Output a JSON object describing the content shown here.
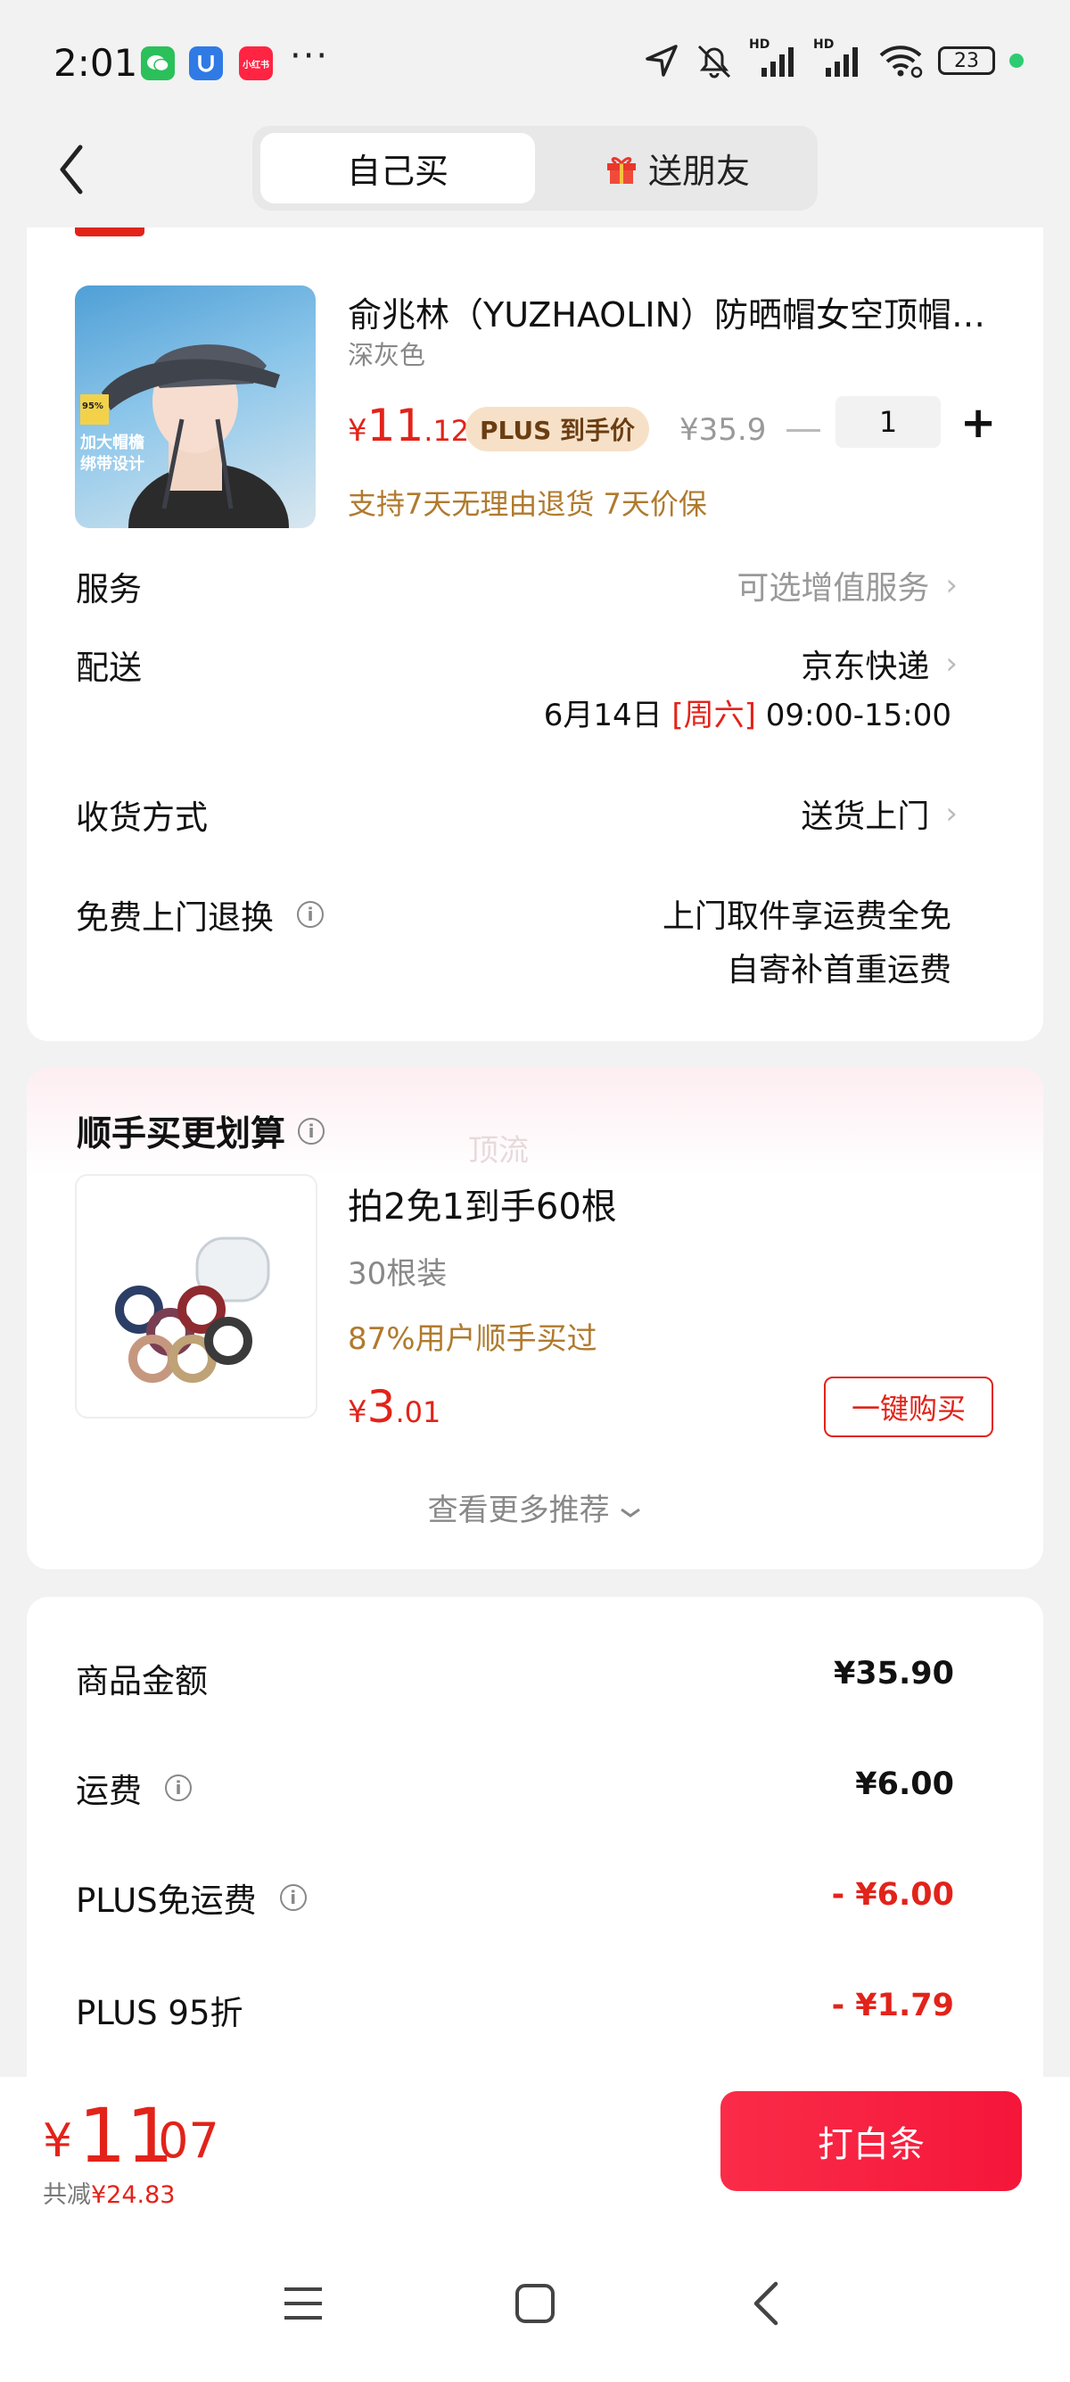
{
  "status_bar": {
    "time": "2:01",
    "apps": [
      "wechat-icon",
      "security-app-icon",
      "xiaohongshu-icon"
    ],
    "xhs_label": "小红书",
    "dots": "···",
    "hd1": "HD",
    "hd2": "HD",
    "battery": "23"
  },
  "header": {
    "tab_self": "自己买",
    "tab_gift": "送朋友"
  },
  "product": {
    "title": "俞兆林（YUZHAOLIN）防晒帽女空顶帽遮阳帽",
    "spec": "深灰色",
    "price_yen": "¥",
    "price_int": "11",
    "price_dec": ".12",
    "plus_pill": "PLUS 到手价",
    "orig_price": "¥35.9",
    "qty": "1",
    "policy": "支持7天无理由退货  7天价保",
    "img_badge": "95%",
    "img_text1": "加大帽檐",
    "img_text2": "绑带设计"
  },
  "rows": {
    "service_label": "服务",
    "service_value": "可选增值服务",
    "delivery_label": "配送",
    "delivery_value": "京东快递",
    "delivery_date": "6月14日",
    "delivery_weekday": "[周六]",
    "delivery_time": "09:00-15:00",
    "receive_label": "收货方式",
    "receive_value": "送货上门",
    "return_label": "免费上门退换",
    "return_line1": "上门取件享运费全免",
    "return_line2": "自寄补首重运费"
  },
  "recommend": {
    "title": "顺手买更划算",
    "watermark": "顶流",
    "item_title": "拍2免1到手60根",
    "item_spec": "30根装",
    "item_hint": "87%用户顺手买过",
    "price_yen": "¥",
    "price_int": "3",
    "price_dec": ".01",
    "buy_label": "一键购买",
    "more_label": "查看更多推荐"
  },
  "summary": {
    "goods_label": "商品金额",
    "goods_value": "¥35.90",
    "freight_label": "运费",
    "freight_value": "¥6.00",
    "plus_free_label": "PLUS免运费",
    "plus_free_value": "- ¥6.00",
    "plus_discount_label": "PLUS 95折",
    "plus_discount_value": "- ¥1.79"
  },
  "bottom": {
    "yen": "¥",
    "total_int": "11",
    "total_dec": ".07",
    "saved_label": "共减",
    "saved_value": "¥24.83",
    "pay_label": "打白条"
  },
  "colors": {
    "accent_red": "#e2231a",
    "gold_text": "#b07a2e",
    "plus_pill_bg": "#f6e1c8"
  }
}
